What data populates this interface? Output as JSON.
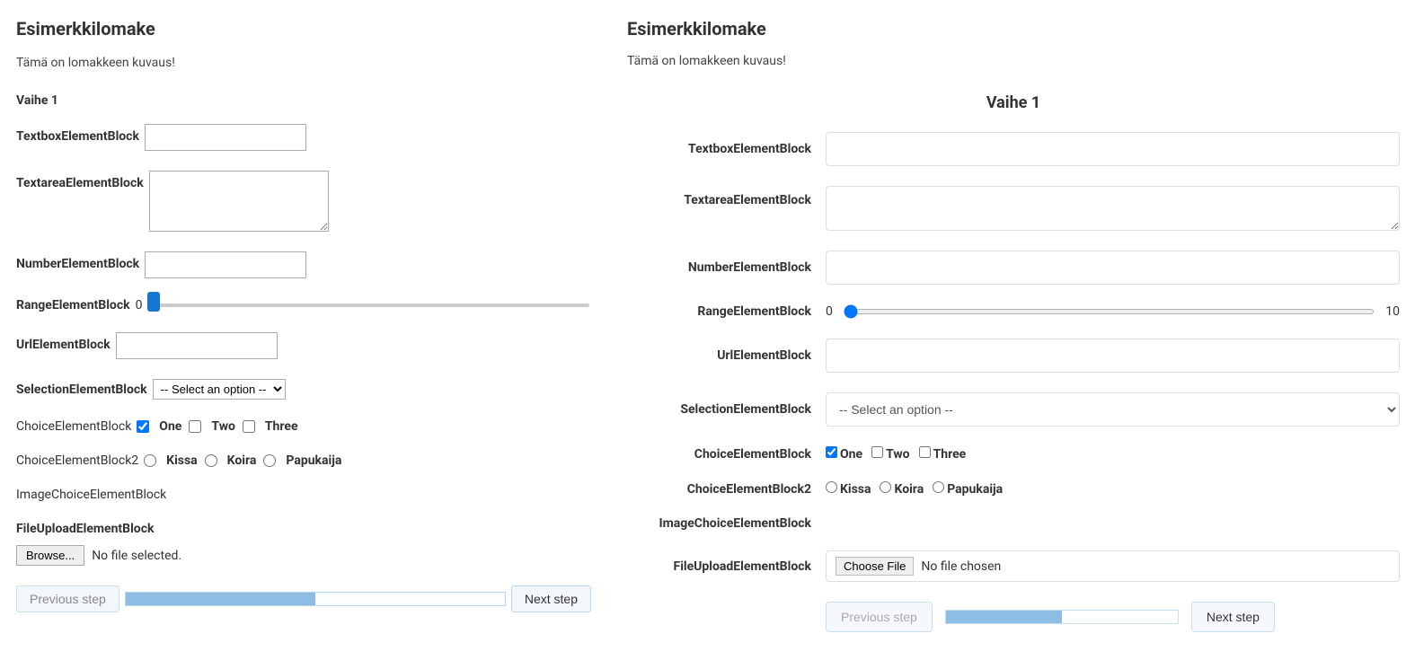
{
  "left": {
    "title": "Esimerkkilomake",
    "description": "Tämä on lomakkeen kuvaus!",
    "step": "Vaihe 1",
    "labels": {
      "textbox": "TextboxElementBlock",
      "textarea": "TextareaElementBlock",
      "number": "NumberElementBlock",
      "range": "RangeElementBlock",
      "url": "UrlElementBlock",
      "selection": "SelectionElementBlock",
      "choice": "ChoiceElementBlock",
      "choice2": "ChoiceElementBlock2",
      "imagechoice": "ImageChoiceElementBlock",
      "fileupload": "FileUploadElementBlock"
    },
    "range_value": "0",
    "select_placeholder": "-- Select an option --",
    "choice_opts": [
      "One",
      "Two",
      "Three"
    ],
    "choice_checked": [
      true,
      false,
      false
    ],
    "choice2_opts": [
      "Kissa",
      "Koira",
      "Papukaija"
    ],
    "file_browse": "Browse...",
    "file_status": "No file selected.",
    "nav": {
      "prev": "Previous step",
      "next": "Next step"
    },
    "progress_pct": 50
  },
  "right": {
    "title": "Esimerkkilomake",
    "description": "Tämä on lomakkeen kuvaus!",
    "step": "Vaihe 1",
    "labels": {
      "textbox": "TextboxElementBlock",
      "textarea": "TextareaElementBlock",
      "number": "NumberElementBlock",
      "range": "RangeElementBlock",
      "url": "UrlElementBlock",
      "selection": "SelectionElementBlock",
      "choice": "ChoiceElementBlock",
      "choice2": "ChoiceElementBlock2",
      "imagechoice": "ImageChoiceElementBlock",
      "fileupload": "FileUploadElementBlock"
    },
    "range_min": "0",
    "range_max": "10",
    "select_placeholder": "-- Select an option --",
    "choice_opts": [
      "One",
      "Two",
      "Three"
    ],
    "choice_checked": [
      true,
      false,
      false
    ],
    "choice2_opts": [
      "Kissa",
      "Koira",
      "Papukaija"
    ],
    "file_browse": "Choose File",
    "file_status": "No file chosen",
    "nav": {
      "prev": "Previous step",
      "next": "Next step"
    },
    "progress_pct": 50
  }
}
